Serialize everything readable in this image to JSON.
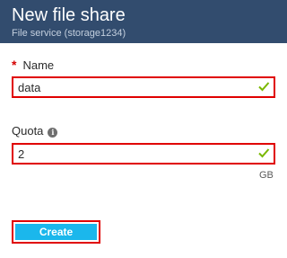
{
  "header": {
    "title": "New file share",
    "subtitle": "File service (storage1234)",
    "background_color": "#324c6e"
  },
  "form": {
    "name": {
      "required_marker": "*",
      "label": "Name",
      "value": "data",
      "valid_icon": "checkmark-icon"
    },
    "quota": {
      "label": "Quota",
      "info_icon": "info-icon",
      "value": "2",
      "unit": "GB",
      "valid_icon": "checkmark-icon"
    }
  },
  "actions": {
    "create_label": "Create",
    "create_color": "#1bb7ec"
  },
  "colors": {
    "highlight_outline": "#e00000",
    "valid_check": "#7ab800"
  }
}
